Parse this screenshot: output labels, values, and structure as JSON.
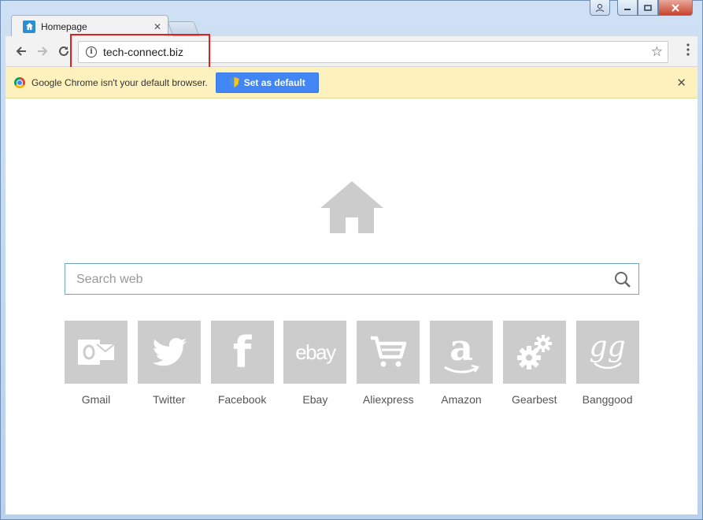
{
  "tab": {
    "title": "Homepage",
    "close": "✕"
  },
  "toolbar": {
    "url": "tech-connect.biz",
    "info": "i"
  },
  "infobar": {
    "message": "Google Chrome isn't your default browser.",
    "button": "Set as default",
    "close": "✕"
  },
  "search": {
    "placeholder": "Search web"
  },
  "tiles": [
    {
      "label": "Gmail",
      "glyph": "O"
    },
    {
      "label": "Twitter",
      "glyph": ""
    },
    {
      "label": "Facebook",
      "glyph": "f"
    },
    {
      "label": "Ebay",
      "glyph": "ebay"
    },
    {
      "label": "Aliexpress",
      "glyph": ""
    },
    {
      "label": "Amazon",
      "glyph": "a"
    },
    {
      "label": "Gearbest",
      "glyph": ""
    },
    {
      "label": "Banggood",
      "glyph": "gg"
    }
  ],
  "colors": {
    "accent": "#4285f4",
    "tile": "#cccccc",
    "highlight": "#e02020"
  }
}
